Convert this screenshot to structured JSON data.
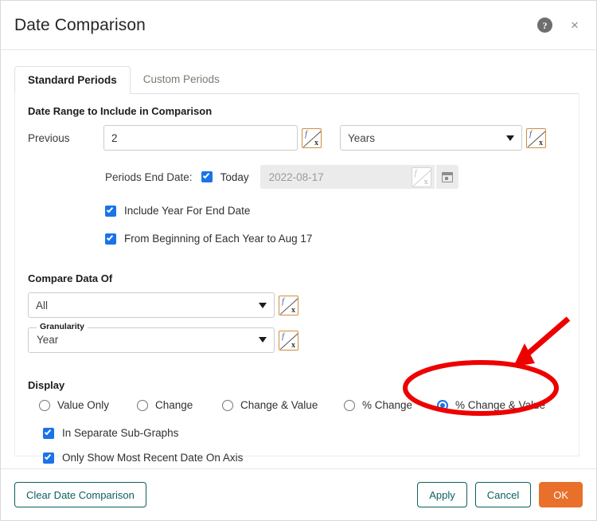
{
  "dialog": {
    "title": "Date Comparison",
    "help_icon": "help-circle-icon",
    "close_icon": "close-icon"
  },
  "tabs": [
    {
      "label": "Standard Periods",
      "active": true
    },
    {
      "label": "Custom Periods",
      "active": false
    }
  ],
  "date_range": {
    "section_title": "Date Range to Include in Comparison",
    "previous_label": "Previous",
    "previous_value": "2",
    "unit_value": "Years",
    "periods_end_date_label": "Periods End Date:",
    "today_label": "Today",
    "today_checked": true,
    "end_date_value": "2022-08-17",
    "end_date_disabled": true,
    "checkboxes": [
      {
        "label": "Include Year For End Date",
        "checked": true
      },
      {
        "label": "From Beginning of Each Year to Aug 17",
        "checked": true
      }
    ]
  },
  "compare_data_of": {
    "section_title": "Compare Data Of",
    "scope_value": "All",
    "granularity_legend": "Granularity",
    "granularity_value": "Year"
  },
  "display": {
    "section_title": "Display",
    "options": [
      {
        "label": "Value Only",
        "selected": false
      },
      {
        "label": "Change",
        "selected": false
      },
      {
        "label": "Change & Value",
        "selected": false
      },
      {
        "label": "% Change",
        "selected": false
      },
      {
        "label": "% Change & Value",
        "selected": true
      }
    ],
    "checkboxes": [
      {
        "label": "In Separate Sub-Graphs",
        "checked": true
      },
      {
        "label": "Only Show Most Recent Date On Axis",
        "checked": true
      }
    ]
  },
  "footer": {
    "clear_label": "Clear Date Comparison",
    "apply_label": "Apply",
    "cancel_label": "Cancel",
    "ok_label": "OK"
  },
  "annotation": {
    "highlight_color": "#ee0000",
    "shape": "ellipse-and-arrow",
    "target": "% Change & Value"
  },
  "colors": {
    "accent_orange": "#e8702a",
    "teal": "#0d6060",
    "checkbox_blue": "#1a73e8",
    "fx_border": "#d08d3f"
  }
}
